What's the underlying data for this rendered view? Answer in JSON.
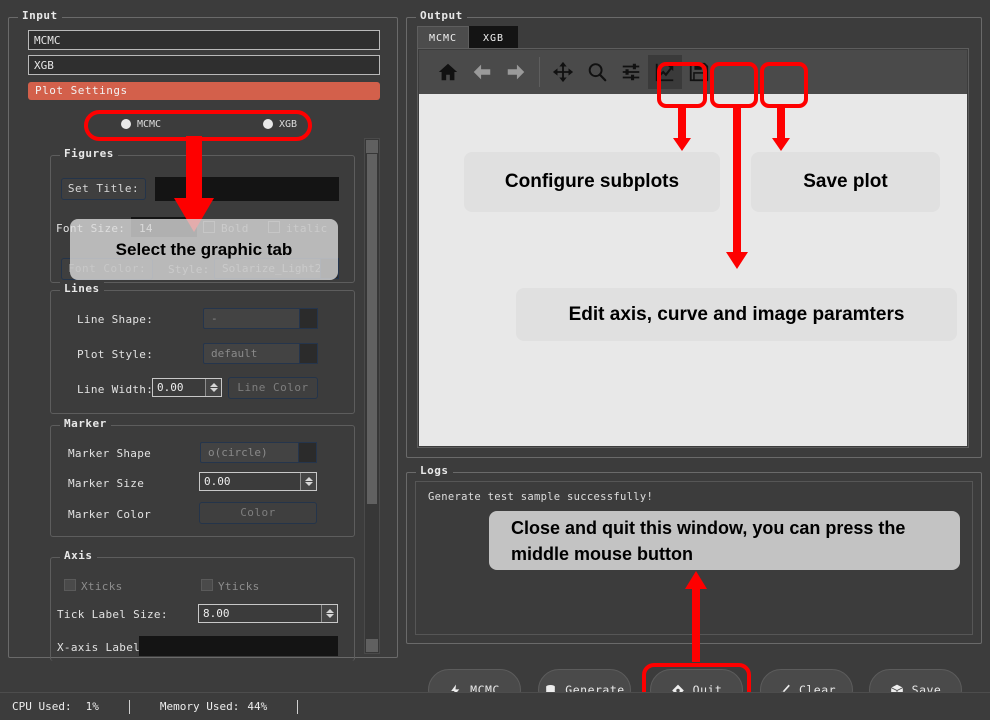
{
  "input": {
    "legend": "Input",
    "field1": "MCMC",
    "field2": "XGB",
    "plot_settings_label": "Plot Settings",
    "radios": [
      {
        "label": "MCMC",
        "selected": true
      },
      {
        "label": "XGB",
        "selected": true
      }
    ],
    "figures": {
      "legend": "Figures",
      "set_title_button": "Set Title:",
      "title_value": "",
      "font_size_label": "Font Size:",
      "font_size_value": "14",
      "bold_label": "Bold",
      "italic_label": "italic",
      "font_color_button": "Font Color:",
      "style_label": "Style:",
      "style_value": "Solarize_Light2"
    },
    "lines": {
      "legend": "Lines",
      "line_shape_label": "Line Shape:",
      "line_shape_value": "-",
      "plot_style_label": "Plot Style:",
      "plot_style_value": "default",
      "line_width_label": "Line Width:",
      "line_width_value": "0.00",
      "line_color_button": "Line Color"
    },
    "marker": {
      "legend": "Marker",
      "marker_shape_label": "Marker Shape",
      "marker_shape_value": "o(circle)",
      "marker_size_label": "Marker Size",
      "marker_size_value": "0.00",
      "marker_color_label": "Marker Color",
      "marker_color_button": "Color"
    },
    "axis": {
      "legend": "Axis",
      "xticks_label": "Xticks",
      "yticks_label": "Yticks",
      "tick_label_size_label": "Tick Label Size:",
      "tick_label_size_value": "8.00",
      "x_axis_label_label": "X-axis Label:",
      "x_axis_label_value": ""
    }
  },
  "output": {
    "legend": "Output",
    "tabs": [
      {
        "label": "MCMC",
        "active": false
      },
      {
        "label": "XGB",
        "active": true
      }
    ],
    "toolbar": [
      {
        "name": "home-icon",
        "title": "Home"
      },
      {
        "name": "arrow-left-icon",
        "title": "Back"
      },
      {
        "name": "arrow-right-icon",
        "title": "Forward"
      },
      {
        "name": "move-icon",
        "title": "Pan"
      },
      {
        "name": "magnifier-icon",
        "title": "Zoom"
      },
      {
        "name": "sliders-icon",
        "title": "Configure subplots"
      },
      {
        "name": "chart-line-icon",
        "title": "Edit axis, curve and image parameters"
      },
      {
        "name": "floppy-disk-icon",
        "title": "Save plot"
      }
    ]
  },
  "logs": {
    "legend": "Logs",
    "lines": "Generate test sample successfully!"
  },
  "actions": [
    {
      "label": "MCMC",
      "icon": "bolt-icon"
    },
    {
      "label": "Generate",
      "icon": "database-icon"
    },
    {
      "label": "Quit",
      "icon": "diamond-icon"
    },
    {
      "label": "Clear",
      "icon": "brush-icon"
    },
    {
      "label": "Save",
      "icon": "box-icon"
    }
  ],
  "statusbar": {
    "cpu_label": "CPU Used:",
    "cpu_value": "1%",
    "memory_label": "Memory Used:",
    "memory_value": "44%"
  },
  "callouts": {
    "select_graphic_tab": "Select the graphic tab",
    "configure_subplots": "Configure subplots",
    "save_plot": "Save plot",
    "edit_axis": "Edit axis, curve and image paramters",
    "quit_hint": "Close and quit this window, you can press the middle mouse button"
  },
  "colors": {
    "accent_red": "#fe0000",
    "plot_settings_bg": "#d3604b",
    "window_bg": "#3c3c3c",
    "canvas_bg": "#e8e8e8"
  }
}
